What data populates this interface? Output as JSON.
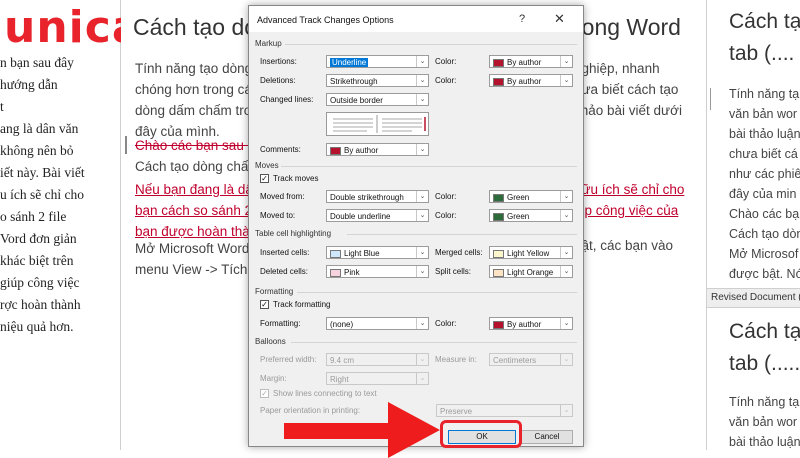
{
  "brand": {
    "logo_text": "unica",
    "color": "#e8232b"
  },
  "left_column": {
    "lines": [
      "n bạn sau đây",
      "hướng dẫn",
      "t",
      "",
      "ang là dân văn",
      "không nên bỏ",
      "iết này. Bài viết",
      "u ích sẽ chỉ cho",
      "o sánh 2 file",
      "Vord đơn giản",
      "khác biệt trên",
      "giúp công việc",
      "rợc hoàn thành",
      "niệu quả hơn."
    ]
  },
  "document": {
    "title_left": "Cách tạo dò",
    "title_right": "rong Word",
    "para1_lines": [
      "Tính năng tạo dòng",
      "chóng hơn trong các",
      "dòng dấm chấm tron",
      "đây của mình."
    ],
    "para1_right": [
      "nghiệp, nhanh",
      "hưa biết cách tạo",
      "khảo bài viết dưới"
    ],
    "strike_text": "Chào các bạn sau đ",
    "plain_line": "Cách tạo dòng chấm t",
    "red_lines": [
      "Nếu bạn đang là dân",
      "bạn cách so sánh 2 fi",
      "bạn được hoàn thành"
    ],
    "red_right": [
      "hữu ích sẽ chỉ cho",
      "iúp công việc của"
    ],
    "last_lines": [
      "Mở Microsoft Word",
      "menu View -> Tích v"
    ],
    "last_right": "bật, các bạn vào"
  },
  "right_pane": {
    "title1_a": "Cách tạ",
    "title1_b": "tab (....",
    "text1": [
      "Tính năng tạ",
      "văn bản wor",
      "bài thảo luận",
      "chưa biết cá",
      "như các phiê",
      "đây của min",
      "Chào các bạ",
      "Cách tạo dòng",
      "Mở Microsof",
      "được bật. Nó"
    ],
    "bar_label": "Revised Document (Ca",
    "title2_a": "Cách tạ",
    "title2_b": "tab (.....",
    "text2": [
      "Tính năng tạ",
      "văn bản wor",
      "bài thảo luận"
    ]
  },
  "dialog": {
    "title": "Advanced Track Changes Options",
    "help_glyph": "?",
    "close_glyph": "✕",
    "arrow_glyph": "⌄",
    "markup": {
      "section": "Markup",
      "insertions_label": "Insertions:",
      "insertions_value": "Underline",
      "deletions_label": "Deletions:",
      "deletions_value": "Strikethrough",
      "changed_lines_label": "Changed lines:",
      "changed_lines_value": "Outside border",
      "comments_label": "Comments:",
      "comments_value": "By author",
      "color_label": "Color:",
      "ins_color": "By author",
      "del_color": "By author"
    },
    "moves": {
      "section": "Moves",
      "track_moves_label": "Track moves",
      "track_moves_checked": "✓",
      "moved_from_label": "Moved from:",
      "moved_from_value": "Double strikethrough",
      "moved_to_label": "Moved to:",
      "moved_to_value": "Double underline",
      "color_label": "Color:",
      "from_color": "Green",
      "to_color": "Green"
    },
    "table": {
      "section": "Table cell highlighting",
      "inserted_label": "Inserted cells:",
      "inserted_value": "Light Blue",
      "deleted_label": "Deleted cells:",
      "deleted_value": "Pink",
      "merged_label": "Merged cells:",
      "merged_value": "Light Yellow",
      "split_label": "Split cells:",
      "split_value": "Light Orange"
    },
    "formatting": {
      "section": "Formatting",
      "track_label": "Track formatting",
      "track_checked": "✓",
      "formatting_label": "Formatting:",
      "formatting_value": "(none)",
      "color_label": "Color:",
      "color_value": "By author"
    },
    "balloons": {
      "section": "Balloons",
      "pref_width_label": "Preferred width:",
      "pref_width_value": "9.4 cm",
      "measure_label": "Measure in:",
      "measure_value": "Centimeters",
      "margin_label": "Margin:",
      "margin_value": "Right",
      "show_lines_label": "Show lines connecting to text",
      "show_lines_checked": "✓",
      "orientation_label": "Paper orientation in printing:",
      "orientation_value": "Preserve"
    },
    "ok_label": "OK",
    "cancel_label": "Cancel"
  },
  "colors": {
    "author_red": "#b5122e",
    "green": "#2e6b3a",
    "light_blue": "#cfe7fb",
    "pink": "#f7d3de",
    "light_yellow": "#fbf6cc",
    "light_orange": "#fce4c4",
    "highlight_arrow": "#ee1c1c",
    "select_blue": "#0078d7"
  }
}
